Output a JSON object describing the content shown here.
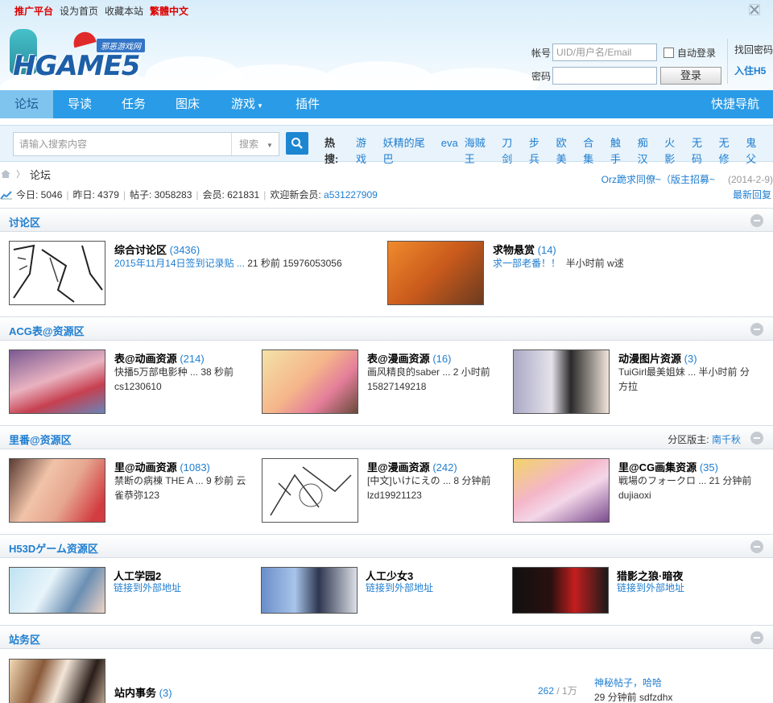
{
  "toplinks": [
    {
      "label": "推广平台",
      "red": true
    },
    {
      "label": "设为首页",
      "red": false
    },
    {
      "label": "收藏本站",
      "red": false
    },
    {
      "label": "繁體中文",
      "red": true
    }
  ],
  "logo": {
    "text": "HGAME5",
    "tag": "邪恶游戏网"
  },
  "login": {
    "account_label": "帐号",
    "account_placeholder": "UID/用户名/Email",
    "password_label": "密码",
    "auto_login": "自动登录",
    "login_button": "登录",
    "forgot": "找回密码",
    "h5": "入住H5"
  },
  "nav": {
    "items": [
      "论坛",
      "导读",
      "任务",
      "图床",
      "游戏",
      "插件"
    ],
    "right": "快捷导航"
  },
  "search": {
    "placeholder": "请输入搜索内容",
    "select": "搜索",
    "hot_label": "热搜:",
    "hot": [
      "游戏",
      "妖精的尾巴",
      "eva",
      "海贼王",
      "刀剑",
      "步兵",
      "欧美",
      "合集",
      "触手",
      "痴汉",
      "火影",
      "无码",
      "无修",
      "鬼父"
    ]
  },
  "breadcrumb": {
    "current": "论坛"
  },
  "notice": {
    "text": "Orz跪求同僚~（版主招募~",
    "date": "(2014-2-9)"
  },
  "stats": {
    "today": "今日: 5046",
    "yesterday": "昨日: 4379",
    "posts": "帖子: 3058283",
    "members": "会员: 621831",
    "newest_label": "欢迎新会员:",
    "newest": "a531227909",
    "latest": "最新回复"
  },
  "sections": {
    "discuss": {
      "title": "讨论区",
      "forums": [
        {
          "name": "综合讨论区",
          "count": "(3436)",
          "link": "2015年11月14日签到记录贴 ...",
          "meta": "21 秒前  15976053056"
        },
        {
          "name": "求物悬赏",
          "count": "(14)",
          "link": "求一部老番！！",
          "meta": "半小时前  w逑"
        }
      ]
    },
    "acg": {
      "title": "ACG表@资源区",
      "forums": [
        {
          "name": "表@动画资源",
          "count": "(214)",
          "line1": "快播5万部电影种 ...  38 秒前",
          "line2": "cs1230610"
        },
        {
          "name": "表@漫画资源",
          "count": "(16)",
          "line1": "画风精良的saber ...  2 小时前",
          "line2": "15827149218"
        },
        {
          "name": "动漫图片资源",
          "count": "(3)",
          "line1": "TuiGirl最美姐妹 ...  半小时前  分",
          "line2": "方拉"
        }
      ]
    },
    "ura": {
      "title": "里番@资源区",
      "moderator_label": "分区版主:",
      "moderator": "南千秋",
      "forums": [
        {
          "name": "里@动画资源",
          "count": "(1083)",
          "line1": "禁断の病棟 THE A ...  9 秒前  云",
          "line2": "雀恭弥123"
        },
        {
          "name": "里@漫画资源",
          "count": "(242)",
          "line1": "[中文]いけにえの ...  8 分钟前",
          "line2": "lzd19921123"
        },
        {
          "name": "里@CG画集资源",
          "count": "(35)",
          "line1": "戦場のフォークロ ...  21 分钟前",
          "line2": "dujiaoxi"
        }
      ]
    },
    "h53d": {
      "title": "H53Dゲーム资源区",
      "forums": [
        {
          "name": "人工学园2",
          "link": "链接到外部地址"
        },
        {
          "name": "人工少女3",
          "link": "链接到外部地址"
        },
        {
          "name": "猎影之狼·暗夜",
          "link": "链接到外部地址"
        }
      ]
    },
    "site": {
      "title": "站务区",
      "forum": {
        "name": "站内事务",
        "count": "(3)",
        "threads": "262",
        "posts": "1万",
        "last_title": "神秘帖子，哈哈",
        "last_meta": "29 分钟前  sdfzdhx"
      }
    }
  },
  "colors": {
    "accent": "#1f7ed0",
    "nav": "#2a9be6",
    "red": "#dd0000"
  }
}
